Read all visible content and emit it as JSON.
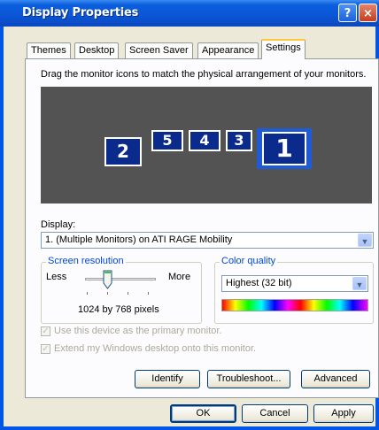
{
  "window": {
    "title": "Display Properties",
    "help_glyph": "?",
    "close_glyph": "×"
  },
  "tabs": [
    {
      "label": "Themes"
    },
    {
      "label": "Desktop"
    },
    {
      "label": "Screen Saver"
    },
    {
      "label": "Appearance"
    },
    {
      "label": "Settings",
      "active": true
    }
  ],
  "settings": {
    "instruction": "Drag the monitor icons to match the physical arrangement of your monitors.",
    "monitors": [
      {
        "number": "2"
      },
      {
        "number": "5"
      },
      {
        "number": "4"
      },
      {
        "number": "3"
      },
      {
        "number": "1",
        "selected": true
      }
    ],
    "display_label": "Display:",
    "display_value": "1. (Multiple Monitors) on ATI RAGE Mobility",
    "screen_resolution": {
      "title": "Screen resolution",
      "less": "Less",
      "more": "More",
      "value": "1024 by 768 pixels"
    },
    "color_quality": {
      "title": "Color quality",
      "value": "Highest (32 bit)"
    },
    "primary_monitor_checkbox": {
      "label": "Use this device as the primary monitor.",
      "checked": true,
      "enabled": false
    },
    "extend_desktop_checkbox": {
      "label": "Extend my Windows desktop onto this monitor.",
      "checked": true,
      "enabled": false
    },
    "buttons": {
      "identify": "Identify",
      "troubleshoot": "Troubleshoot...",
      "advanced": "Advanced"
    }
  },
  "dialog_buttons": {
    "ok": "OK",
    "cancel": "Cancel",
    "apply": "Apply"
  },
  "colors": {
    "titlebar": "#0a5fdc",
    "monitor_area": "#535353",
    "monitor_fill": "#0a2b8c",
    "selected_monitor": "#1f5bd6",
    "group_title": "#0046d5"
  }
}
